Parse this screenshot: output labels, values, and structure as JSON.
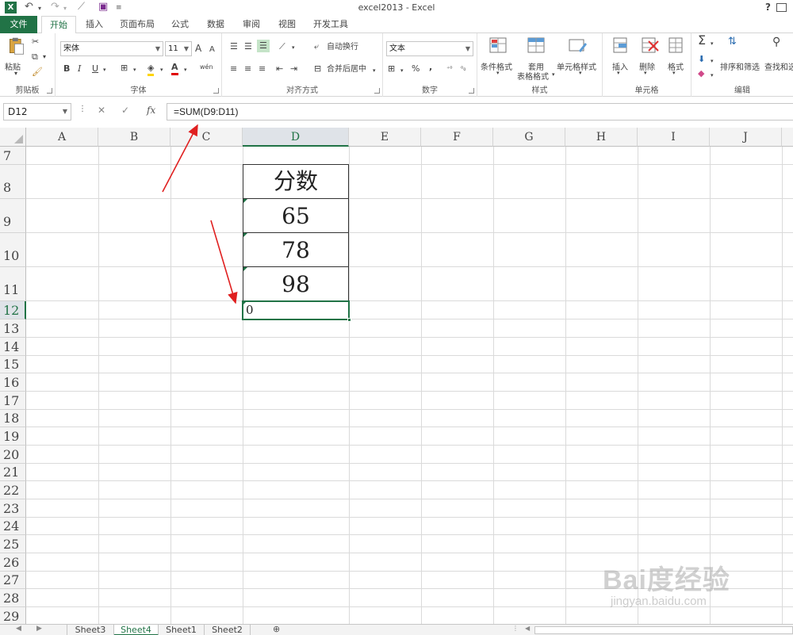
{
  "window": {
    "title": "excel2013 - Excel",
    "help": "?",
    "app_logo": "X"
  },
  "quick_access": [
    "save-icon",
    "undo-icon",
    "redo-icon",
    "touch-mode-icon",
    "customize-icon"
  ],
  "tabs": [
    "文件",
    "开始",
    "插入",
    "页面布局",
    "公式",
    "数据",
    "审阅",
    "视图",
    "开发工具"
  ],
  "ribbon": {
    "clipboard": {
      "label": "剪贴板",
      "paste": "粘贴"
    },
    "font": {
      "label": "字体",
      "name": "宋体",
      "size": "11",
      "bold": "B",
      "italic": "I",
      "underline": "U",
      "grow": "A",
      "shrink": "A",
      "wen": "wén",
      "color_letter": "A"
    },
    "alignment": {
      "label": "对齐方式",
      "wrap": "自动换行",
      "merge": "合并后居中"
    },
    "number": {
      "label": "数字",
      "format": "文本",
      "percent": "%",
      "comma": ","
    },
    "styles": {
      "label": "样式",
      "conditional": "条件格式",
      "table_1": "套用",
      "table_2": "表格格式",
      "cell_styles": "单元格样式"
    },
    "cells": {
      "label": "单元格",
      "insert": "插入",
      "delete": "删除",
      "format": "格式"
    },
    "editing": {
      "label": "编辑",
      "sort": "排序和筛选",
      "find": "查找和选"
    }
  },
  "formula_bar": {
    "name_box": "D12",
    "fx": "fx",
    "formula": "=SUM(D9:D11)"
  },
  "columns": [
    "A",
    "B",
    "C",
    "D",
    "E",
    "F",
    "G",
    "H",
    "I",
    "J"
  ],
  "rows": [
    "7",
    "8",
    "9",
    "10",
    "11",
    "12",
    "13",
    "14",
    "15",
    "16",
    "17",
    "18",
    "19",
    "20",
    "21",
    "22",
    "23",
    "24",
    "25",
    "26",
    "27",
    "28",
    "29"
  ],
  "table": {
    "header": "分数",
    "values": [
      "65",
      "78",
      "98"
    ],
    "sum_result": "0"
  },
  "sheets": [
    "Sheet3",
    "Sheet4",
    "Sheet1",
    "Sheet2"
  ],
  "active_sheet": "Sheet4",
  "watermark": {
    "text": "Bai度经验",
    "url": "jingyan.baidu.com"
  },
  "colors": {
    "excel_green": "#217346",
    "arrow_red": "#e02020"
  }
}
